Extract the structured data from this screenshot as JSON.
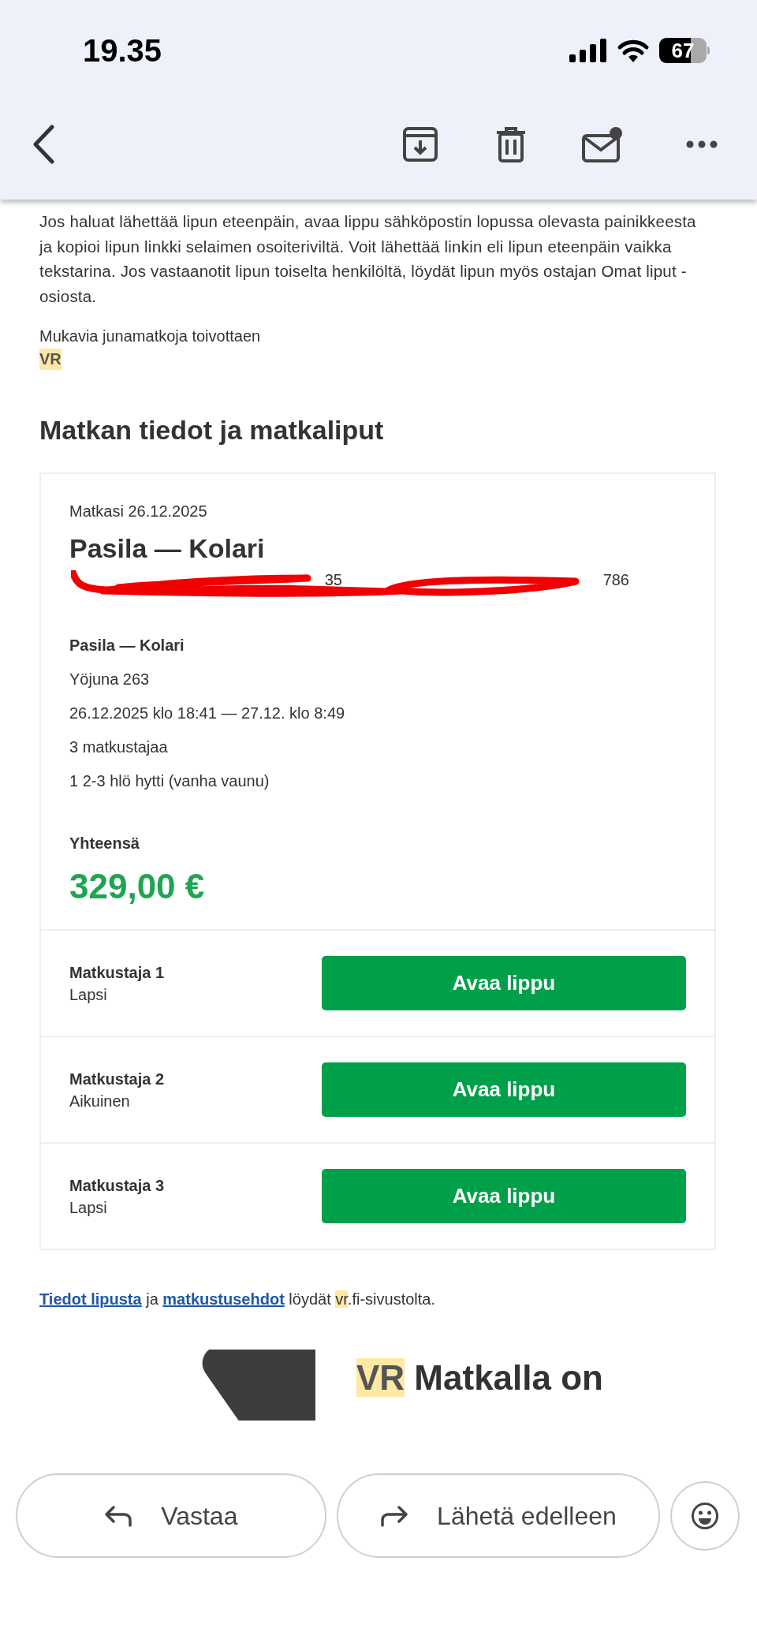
{
  "status_bar": {
    "time": "19.35",
    "battery": "67"
  },
  "email": {
    "paragraph": "Jos haluat lähettää lipun eteenpäin, avaa lippu sähköpostin lopussa olevasta painikkeesta ja kopioi lipun linkki selaimen osoiteriviltä. Voit lähettää linkin eli lipun eteenpäin vaikka tekstarina. Jos vastaanotit lipun toiselta henkilöltä, löydät lipun myös ostajan Omat liput -osiosta.",
    "closing": "Mukavia junamatkoja toivottaen",
    "signature": "VR",
    "heading": "Matkan tiedot ja matkaliput",
    "card": {
      "date_line": "Matkasi 26.12.2025",
      "route_title": "Pasila — Kolari",
      "redacted_fields": [
        {
          "visible_tail": "35"
        },
        {
          "visible_tail": "786"
        }
      ],
      "leg": {
        "route": "Pasila — Kolari",
        "details": [
          "Yöjuna 263",
          "26.12.2025 klo 18:41 — 27.12. klo 8:49",
          "3 matkustajaa",
          "1 2-3 hlö hytti (vanha vaunu)"
        ]
      },
      "total_label": "Yhteensä",
      "total": "329,00 €",
      "passengers": [
        {
          "name": "Matkustaja 1",
          "type": "Lapsi",
          "button": "Avaa lippu"
        },
        {
          "name": "Matkustaja 2",
          "type": "Aikuinen",
          "button": "Avaa lippu"
        },
        {
          "name": "Matkustaja 3",
          "type": "Lapsi",
          "button": "Avaa lippu"
        }
      ]
    },
    "footer_note": [
      {
        "kind": "link",
        "text": "Tiedot lipusta"
      },
      {
        "kind": "text",
        "text": " ja "
      },
      {
        "kind": "link",
        "text": "matkustusehdot"
      },
      {
        "kind": "text",
        "text": " löydät "
      },
      {
        "kind": "highlight",
        "text": "vr"
      },
      {
        "kind": "text",
        "text": ".fi-sivustolta."
      }
    ],
    "promo_title": [
      {
        "kind": "highlight",
        "text": "VR"
      },
      {
        "kind": "text",
        "text": " Matkalla on"
      }
    ]
  },
  "actions": [
    {
      "kind": "reply",
      "label": "Vastaa"
    },
    {
      "kind": "forward",
      "label": "Lähetä edelleen"
    }
  ]
}
